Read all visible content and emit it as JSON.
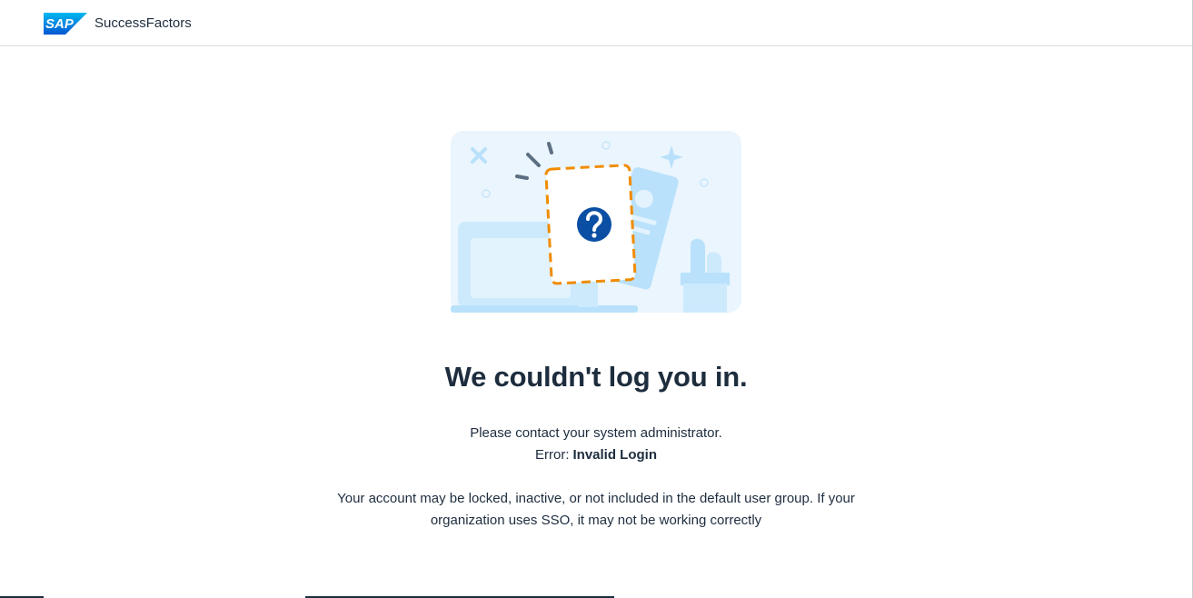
{
  "header": {
    "brand_logo_text": "SAP",
    "product_name": "SuccessFactors",
    "brand_color": "#0a6ed1"
  },
  "illustration": {
    "icon": "question-icon",
    "accent_color": "#f08c00",
    "icon_color": "#0a4fa3"
  },
  "message": {
    "title": "We couldn't log you in.",
    "instruction": "Please contact your system administrator.",
    "error_label": "Error:",
    "error_value": "Invalid Login",
    "note": "Your account may be locked, inactive, or not included in the default user group. If your organization uses SSO, it may not be working correctly"
  }
}
